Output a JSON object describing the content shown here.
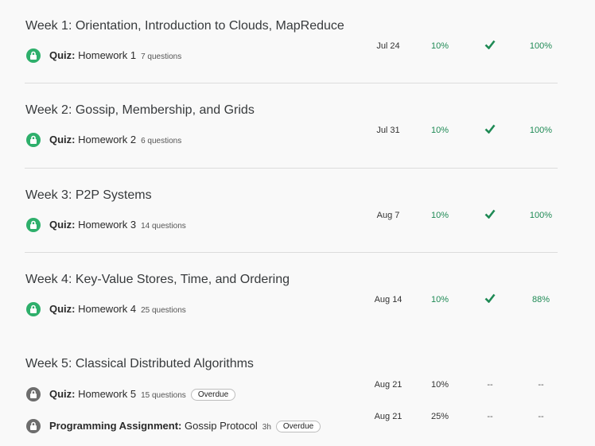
{
  "weeks": [
    {
      "title": "Week 1: Orientation, Introduction to Clouds, MapReduce",
      "items": [
        {
          "kind": "Quiz:",
          "name": "Homework 1",
          "meta": "7 questions",
          "badge": "",
          "due": "Jul 24",
          "weight": "10%",
          "status": "check",
          "grade": "100%",
          "locked": true
        }
      ]
    },
    {
      "title": "Week 2: Gossip, Membership, and Grids",
      "items": [
        {
          "kind": "Quiz:",
          "name": "Homework 2",
          "meta": "6 questions",
          "badge": "",
          "due": "Jul 31",
          "weight": "10%",
          "status": "check",
          "grade": "100%",
          "locked": true
        }
      ]
    },
    {
      "title": "Week 3: P2P Systems",
      "items": [
        {
          "kind": "Quiz:",
          "name": "Homework 3",
          "meta": "14 questions",
          "badge": "",
          "due": "Aug 7",
          "weight": "10%",
          "status": "check",
          "grade": "100%",
          "locked": true
        }
      ]
    },
    {
      "title": "Week 4: Key-Value Stores, Time, and Ordering",
      "items": [
        {
          "kind": "Quiz:",
          "name": "Homework 4",
          "meta": "25 questions",
          "badge": "",
          "due": "Aug 14",
          "weight": "10%",
          "status": "check",
          "grade": "88%",
          "locked": true
        }
      ]
    },
    {
      "title": "Week 5: Classical Distributed Algorithms",
      "items": [
        {
          "kind": "Quiz:",
          "name": "Homework 5",
          "meta": "15 questions",
          "badge": "Overdue",
          "due": "Aug 21",
          "weight": "10%",
          "status": "--",
          "grade": "--",
          "locked": true
        },
        {
          "kind": "Programming Assignment:",
          "name": "Gossip Protocol",
          "meta": "3h",
          "badge": "Overdue",
          "due": "Aug 21",
          "weight": "25%",
          "status": "--",
          "grade": "--",
          "locked": true
        }
      ]
    }
  ],
  "colors": {
    "accent_green": "#2eaf6b",
    "lock_gray": "#6d6d6d",
    "text_green": "#1f8a55"
  }
}
